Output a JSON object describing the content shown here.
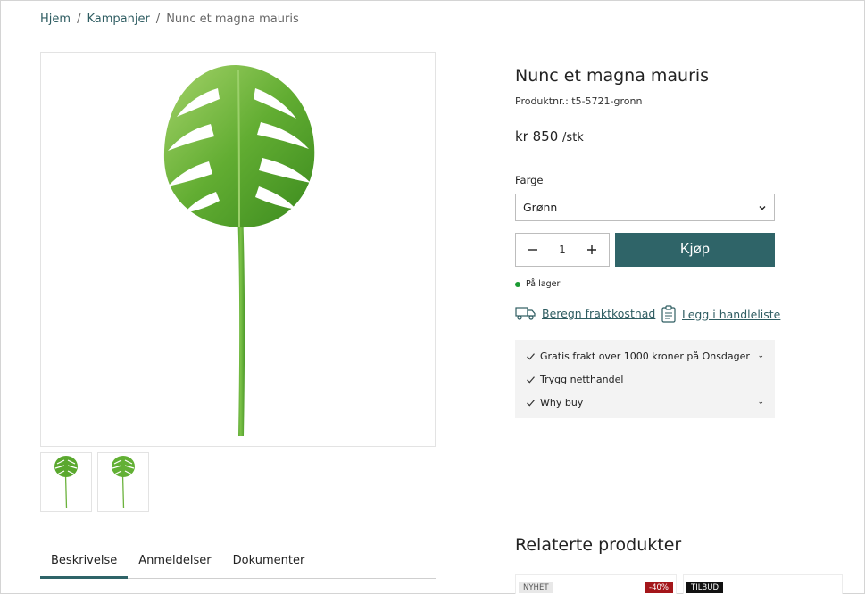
{
  "breadcrumb": {
    "items": [
      "Hjem",
      "Kampanjer"
    ],
    "current": "Nunc et magna mauris",
    "separator": "/"
  },
  "product": {
    "title": "Nunc et magna mauris",
    "sku": "Produktnr.: t5-5721-gronn",
    "price": "kr 850",
    "price_unit": "/stk",
    "color_label": "Farge",
    "color_value": "Grønn",
    "quantity": "1",
    "buy_label": "Kjøp",
    "stock_text": "På lager",
    "stock_color": "#1a9a32",
    "freight_link": "Beregn fraktkostnad",
    "list_link": "Legg i handleliste",
    "accent_color": "#2f6468"
  },
  "usps": [
    {
      "label": "Gratis frakt over 1000 kroner på Onsdager",
      "expandable": true
    },
    {
      "label": "Trygg netthandel",
      "expandable": false
    },
    {
      "label": "Why buy",
      "expandable": true
    }
  ],
  "tabs": [
    {
      "label": "Beskrivelse",
      "active": true
    },
    {
      "label": "Anmeldelser",
      "active": false
    },
    {
      "label": "Dokumenter",
      "active": false
    }
  ],
  "related": {
    "title": "Relaterte produkter",
    "cards": [
      {
        "badge": "NYHET",
        "discount": "-40%"
      },
      {
        "badge": "TILBUD"
      }
    ]
  },
  "icons": {
    "freight": "truck-icon",
    "list": "clipboard-icon",
    "check": "check-icon",
    "dropdown": "chevron-down-icon"
  }
}
